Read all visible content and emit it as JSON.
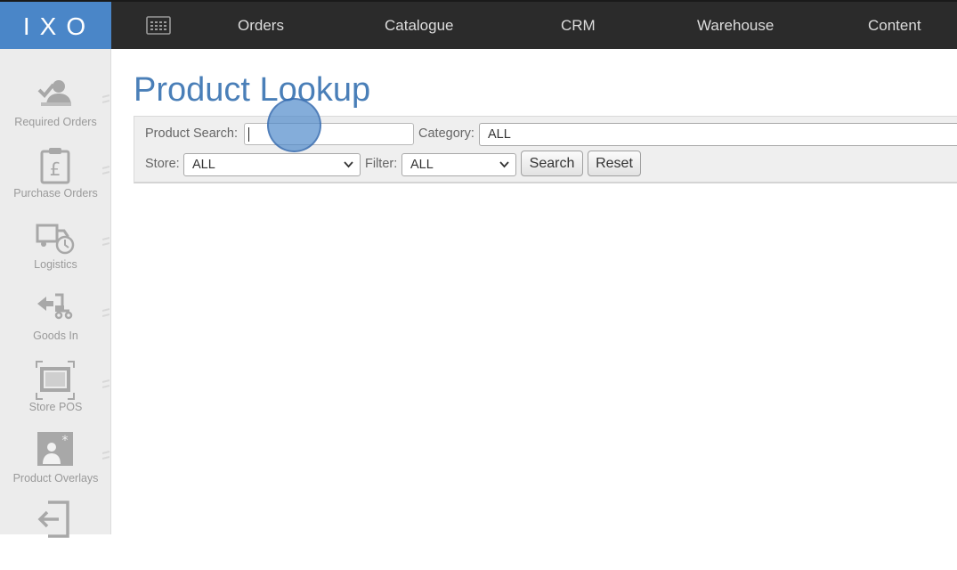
{
  "app": {
    "logo": "IXO"
  },
  "nav": {
    "items": [
      {
        "label": "Orders"
      },
      {
        "label": "Catalogue"
      },
      {
        "label": "CRM"
      },
      {
        "label": "Warehouse"
      },
      {
        "label": "Content"
      }
    ]
  },
  "sidebar": {
    "items": [
      {
        "label": "Required Orders",
        "icon": "required-orders-icon"
      },
      {
        "label": "Purchase Orders",
        "icon": "purchase-orders-icon"
      },
      {
        "label": "Logistics",
        "icon": "logistics-truck-icon"
      },
      {
        "label": "Goods In",
        "icon": "goods-in-icon"
      },
      {
        "label": "Store POS",
        "icon": "store-pos-icon"
      },
      {
        "label": "Product Overlays",
        "icon": "product-overlays-icon"
      },
      {
        "label": "",
        "icon": "exit-icon"
      }
    ]
  },
  "page": {
    "title": "Product Lookup"
  },
  "form": {
    "product_search_label": "Product Search:",
    "product_search_value": "",
    "category_label": "Category:",
    "category_value": "ALL",
    "store_label": "Store:",
    "store_value": "ALL",
    "filter_label": "Filter:",
    "filter_value": "ALL",
    "search_button": "Search",
    "reset_button": "Reset"
  },
  "colors": {
    "accent": "#4a86c8",
    "title": "#4a7fb8",
    "topbar": "#2b2b2b",
    "sidebar": "#ececec"
  }
}
